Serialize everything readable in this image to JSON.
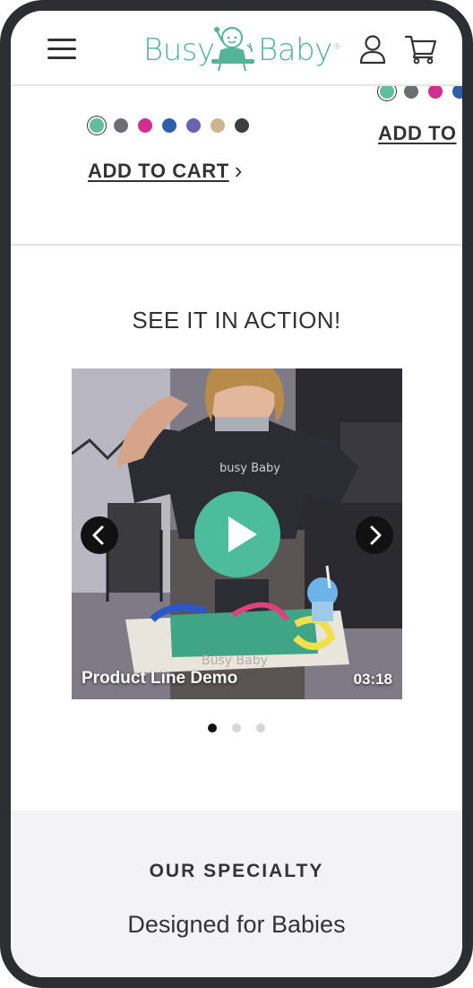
{
  "header": {
    "logo": {
      "text_left": "Busy",
      "text_right": "Baby"
    },
    "menu_icon": "hamburger-menu-icon",
    "account_icon": "user-icon",
    "cart_icon": "shopping-cart-icon"
  },
  "products": [
    {
      "swatches": [
        "#5fbe9e",
        "#6b6e73",
        "#d12f8e",
        "#2f5fa8",
        "#6a63b0",
        "#cdb593",
        "#3e3e3e"
      ],
      "selected_swatch": 0,
      "add_to_cart_label": "ADD TO CART"
    },
    {
      "swatches": [
        "#5fbe9e",
        "#6b6e73",
        "#d12f8e",
        "#2f5fa8"
      ],
      "selected_swatch": 0,
      "add_to_cart_label": "ADD TO"
    }
  ],
  "video_section": {
    "title": "SEE IT IN ACTION!",
    "video": {
      "title": "Product Line Demo",
      "duration": "03:18",
      "play_icon": "play-icon",
      "prev_icon": "chevron-left-icon",
      "next_icon": "chevron-right-icon",
      "accent": "#4cbc9c"
    },
    "pagination": {
      "count": 3,
      "active": 0
    }
  },
  "specialty": {
    "label": "OUR SPECIALTY",
    "heading": "Designed for Babies"
  },
  "colors": {
    "brand": "#53b49a",
    "text": "#333333",
    "section_bg": "#f3f3f6"
  }
}
